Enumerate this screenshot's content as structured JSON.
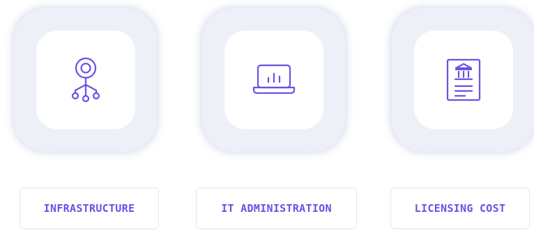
{
  "accent_color": "#6b4fe6",
  "cards": [
    {
      "icon": "network-hub-icon"
    },
    {
      "icon": "laptop-chart-icon"
    },
    {
      "icon": "document-bank-icon"
    }
  ],
  "labels": [
    {
      "text": "INFRASTRUCTURE"
    },
    {
      "text": "IT ADMINISTRATION"
    },
    {
      "text": "LICENSING COST"
    }
  ]
}
